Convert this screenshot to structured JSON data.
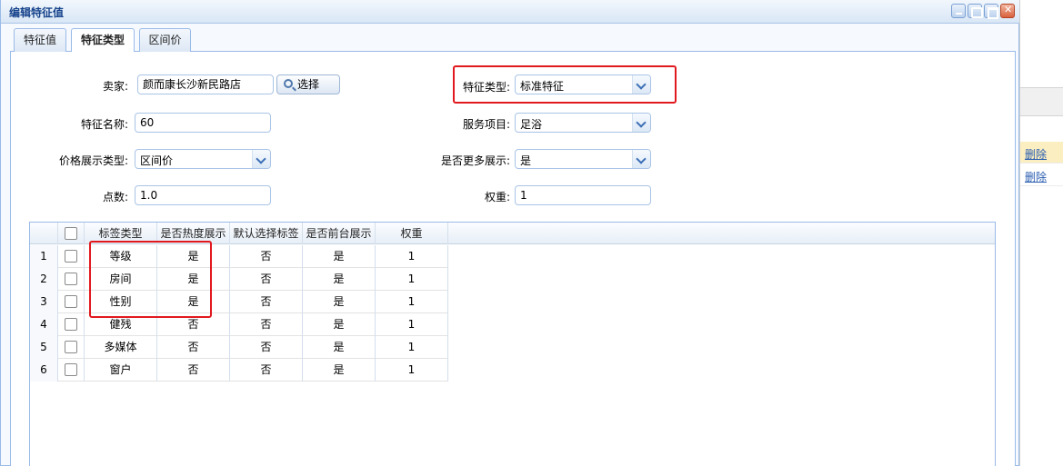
{
  "window": {
    "title": "编辑特征值"
  },
  "tabs": [
    {
      "label": "特征值",
      "active": false
    },
    {
      "label": "特征类型",
      "active": true
    },
    {
      "label": "区间价",
      "active": false
    }
  ],
  "form": {
    "seller_label": "卖家:",
    "seller_value": "颜而康长沙新民路店",
    "select_button": "选择",
    "feature_type_label": "特征类型:",
    "feature_type_value": "标准特征",
    "feature_name_label": "特征名称:",
    "feature_name_value": "60",
    "service_item_label": "服务项目:",
    "service_item_value": "足浴",
    "price_display_label": "价格展示类型:",
    "price_display_value": "区间价",
    "more_display_label": "是否更多展示:",
    "more_display_value": "是",
    "points_label": "点数:",
    "points_value": "1.0",
    "weight_label": "权重:",
    "weight_value": "1"
  },
  "grid": {
    "columns": [
      "标签类型",
      "是否热度展示",
      "默认选择标签",
      "是否前台展示",
      "权重"
    ],
    "rows": [
      {
        "num": "1",
        "tag_type": "等级",
        "hot": "是",
        "default": "否",
        "front": "是",
        "weight": "1"
      },
      {
        "num": "2",
        "tag_type": "房间",
        "hot": "是",
        "default": "否",
        "front": "是",
        "weight": "1"
      },
      {
        "num": "3",
        "tag_type": "性别",
        "hot": "是",
        "default": "否",
        "front": "是",
        "weight": "1"
      },
      {
        "num": "4",
        "tag_type": "健残",
        "hot": "否",
        "default": "否",
        "front": "是",
        "weight": "1"
      },
      {
        "num": "5",
        "tag_type": "多媒体",
        "hot": "否",
        "default": "否",
        "front": "是",
        "weight": "1"
      },
      {
        "num": "6",
        "tag_type": "窗户",
        "hot": "否",
        "default": "否",
        "front": "是",
        "weight": "1"
      }
    ]
  },
  "background": {
    "links": [
      "删除",
      "删除"
    ]
  },
  "colors": {
    "highlight_box": "#e1191f",
    "border": "#99bbe8",
    "title": "#15428b"
  },
  "icons": [
    "search-icon",
    "chevron-down-icon",
    "minimize-icon",
    "maximize-icon",
    "restore-icon",
    "close-icon",
    "checkbox-icon"
  ]
}
